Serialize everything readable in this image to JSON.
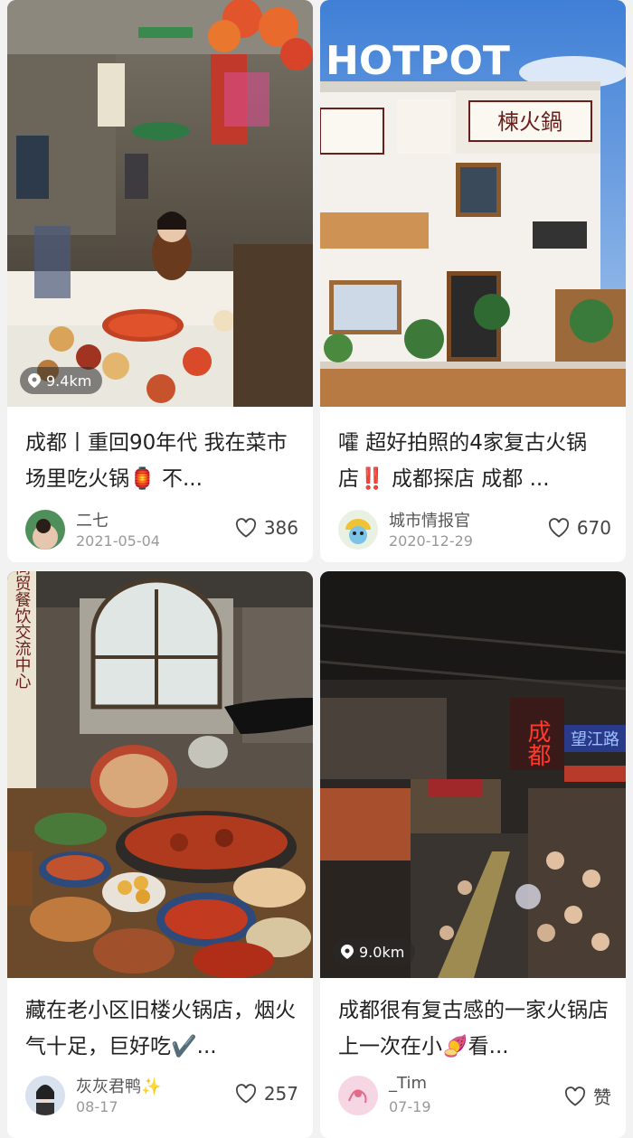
{
  "posts": [
    {
      "distance": "9.4km",
      "title": "成都丨重回90年代 我在菜市场里吃火锅🏮 不...",
      "author": "二七",
      "date": "2021-05-04",
      "likes": "386",
      "image_text": {
        "sign": ""
      }
    },
    {
      "distance": "",
      "title": "嚯 超好拍照的4家复古火锅店‼️ 成都探店 成都 ...",
      "author": "城市情报官",
      "date": "2020-12-29",
      "likes": "670",
      "image_text": {
        "overlay": "HOTPOT",
        "sign": "楝火鍋"
      }
    },
    {
      "distance": "",
      "title": "藏在老小区旧楼火锅店，烟火气十足，巨好吃✔️...",
      "author": "灰灰君鸭✨",
      "date": "08-17",
      "likes": "257",
      "image_text": {
        "banner": "东光商贸餐饮交流中心"
      }
    },
    {
      "distance": "9.0km",
      "title": "成都很有复古感的一家火锅店 上一次在小🍠看...",
      "author": "_Tim",
      "date": "07-19",
      "likes": "赞",
      "image_text": {
        "neon": "成都",
        "neon2": "望江路"
      }
    }
  ]
}
